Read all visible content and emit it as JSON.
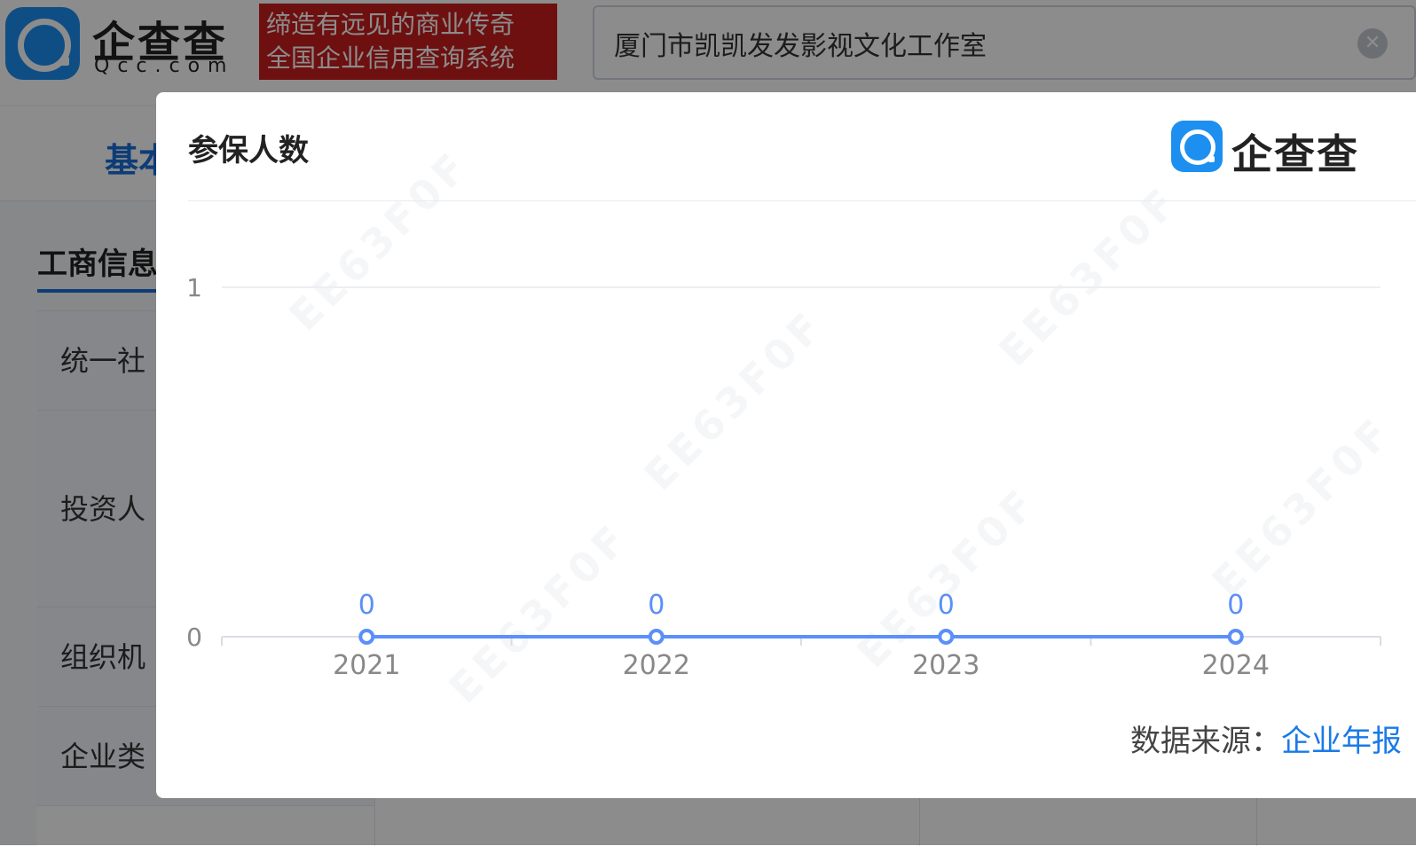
{
  "header": {
    "logo_text": "企查查",
    "logo_domain": "Qcc.com",
    "slogan_line1": "缔造有远见的商业传奇",
    "slogan_line2": "全国企业信用查询系统",
    "search_value": "厦门市凯凯发发影视文化工作室",
    "clear_icon": "✕"
  },
  "background": {
    "tab_basic": "基本",
    "section_title": "工商信息",
    "rows": [
      "统一社",
      "投资人",
      "组织机",
      "企业类"
    ]
  },
  "modal": {
    "title": "参保人数",
    "logo_text": "企查查",
    "source_label": "数据来源：",
    "source_link": "企业年报"
  },
  "colors": {
    "line": "#5b8ff9",
    "accent": "#1a7ae8",
    "brand": "#1d8ff0"
  },
  "chart_data": {
    "type": "line",
    "categories": [
      "2021",
      "2022",
      "2023",
      "2024"
    ],
    "series": [
      {
        "values": [
          0,
          0,
          0,
          0
        ]
      }
    ],
    "ylim": [
      0,
      1
    ],
    "yticks": [
      "0",
      "1"
    ],
    "data_labels": [
      "0",
      "0",
      "0",
      "0"
    ],
    "grid": true
  }
}
